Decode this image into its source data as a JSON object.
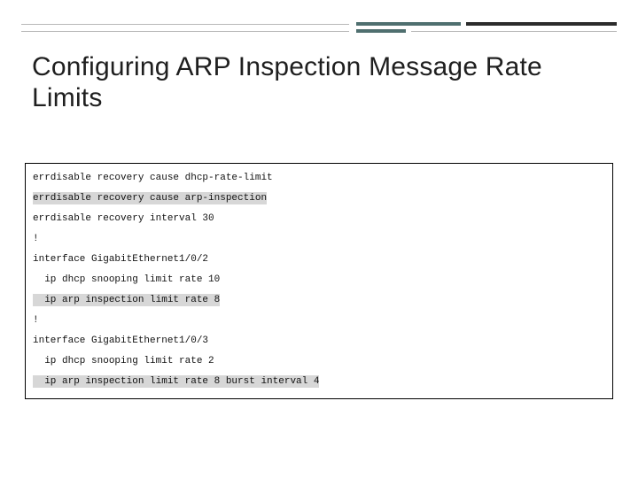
{
  "title": "Configuring ARP Inspection Message Rate Limits",
  "code": {
    "lines": [
      {
        "text": "errdisable recovery cause dhcp-rate-limit",
        "highlight": false
      },
      {
        "text": "errdisable recovery cause arp-inspection",
        "highlight": true
      },
      {
        "text": "errdisable recovery interval 30",
        "highlight": false
      },
      {
        "text": "!",
        "highlight": false
      },
      {
        "text": "interface GigabitEthernet1/0/2",
        "highlight": false
      },
      {
        "text": "  ip dhcp snooping limit rate 10",
        "highlight": false
      },
      {
        "text": "  ip arp inspection limit rate 8",
        "highlight": true
      },
      {
        "text": "!",
        "highlight": false
      },
      {
        "text": "interface GigabitEthernet1/0/3",
        "highlight": false
      },
      {
        "text": "  ip dhcp snooping limit rate 2",
        "highlight": false
      },
      {
        "text": "  ip arp inspection limit rate 8 burst interval 4",
        "highlight": true
      }
    ]
  }
}
